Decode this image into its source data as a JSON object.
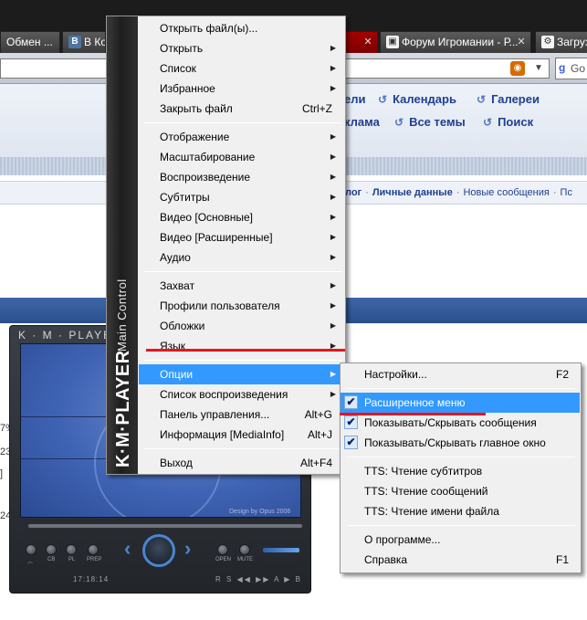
{
  "browser": {
    "tabs": [
      {
        "label": "Обмен ...",
        "favicon": "page-icon",
        "active": false
      },
      {
        "label": "В Ко",
        "favicon": "vk-icon",
        "active": false
      },
      {
        "label": "Форум Игромании - Р...",
        "favicon": "forum-icon",
        "active": false
      },
      {
        "label": "Загруз",
        "favicon": "download-icon",
        "active": false
      }
    ],
    "search_engine_label": "Go"
  },
  "page": {
    "nav_row1": [
      "ели",
      "Календарь",
      "Галереи"
    ],
    "nav_row2": [
      "клама",
      "Все темы",
      "Поиск"
    ],
    "subnav": {
      "lead": "лог",
      "bold": "Личные данные",
      "items": [
        "Новые сообщения",
        "Пс"
      ]
    },
    "left_edge": [
      "7%",
      "23",
      "]",
      "24"
    ]
  },
  "kmplayer": {
    "title": "K · M · PLAYER",
    "design_credit": "Design by Opus 2006",
    "time": "17:18:14",
    "right_indicators": "R S ◀◀ ▶▶ A ▶ B",
    "button_labels": [
      "CB",
      "PL",
      "PREP",
      "OPEN",
      "MUTE"
    ]
  },
  "main_menu": {
    "side_label": "Main Control",
    "side_logo": "K·M·PLAYER",
    "groups": [
      [
        {
          "label": "Открыть файл(ы)...",
          "shortcut": "",
          "submenu": false
        },
        {
          "label": "Открыть",
          "shortcut": "",
          "submenu": true
        },
        {
          "label": "Список",
          "shortcut": "",
          "submenu": true
        },
        {
          "label": "Избранное",
          "shortcut": "",
          "submenu": true
        },
        {
          "label": "Закрыть файл",
          "shortcut": "Ctrl+Z",
          "submenu": false
        }
      ],
      [
        {
          "label": "Отображение",
          "shortcut": "",
          "submenu": true
        },
        {
          "label": "Масштабирование",
          "shortcut": "",
          "submenu": true
        },
        {
          "label": "Воспроизведение",
          "shortcut": "",
          "submenu": true
        },
        {
          "label": "Субтитры",
          "shortcut": "",
          "submenu": true
        },
        {
          "label": "Видео [Основные]",
          "shortcut": "",
          "submenu": true
        },
        {
          "label": "Видео [Расширенные]",
          "shortcut": "",
          "submenu": true
        },
        {
          "label": "Аудио",
          "shortcut": "",
          "submenu": true
        }
      ],
      [
        {
          "label": "Захват",
          "shortcut": "",
          "submenu": true
        },
        {
          "label": "Профили пользователя",
          "shortcut": "",
          "submenu": true
        },
        {
          "label": "Обложки",
          "shortcut": "",
          "submenu": true
        },
        {
          "label": "Язык",
          "shortcut": "",
          "submenu": true
        }
      ],
      [
        {
          "label": "Опции",
          "shortcut": "",
          "submenu": true,
          "highlighted": true
        },
        {
          "label": "Список воспроизведения",
          "shortcut": "",
          "submenu": true
        },
        {
          "label": "Панель управления...",
          "shortcut": "Alt+G",
          "submenu": false
        },
        {
          "label": "Информация [MediaInfo]",
          "shortcut": "Alt+J",
          "submenu": false
        }
      ],
      [
        {
          "label": "Выход",
          "shortcut": "Alt+F4",
          "submenu": false
        }
      ]
    ]
  },
  "options_submenu": {
    "groups": [
      [
        {
          "label": "Настройки...",
          "shortcut": "F2",
          "checked": false
        }
      ],
      [
        {
          "label": "Расширенное меню",
          "shortcut": "",
          "checked": true,
          "highlighted": true
        },
        {
          "label": "Показывать/Скрывать сообщения",
          "shortcut": "",
          "checked": true
        },
        {
          "label": "Показывать/Скрывать главное окно",
          "shortcut": "",
          "checked": true
        }
      ],
      [
        {
          "label": "TTS: Чтение субтитров",
          "shortcut": "",
          "checked": false
        },
        {
          "label": "TTS: Чтение сообщений",
          "shortcut": "",
          "checked": false
        },
        {
          "label": "TTS: Чтение имени файла",
          "shortcut": "",
          "checked": false
        }
      ],
      [
        {
          "label": "О программе...",
          "shortcut": "",
          "checked": false
        },
        {
          "label": "Справка",
          "shortcut": "F1",
          "checked": false
        }
      ]
    ]
  },
  "colors": {
    "menu_highlight": "#3399ff",
    "annotation_red": "#e8141e",
    "active_tab": "#a40000"
  }
}
